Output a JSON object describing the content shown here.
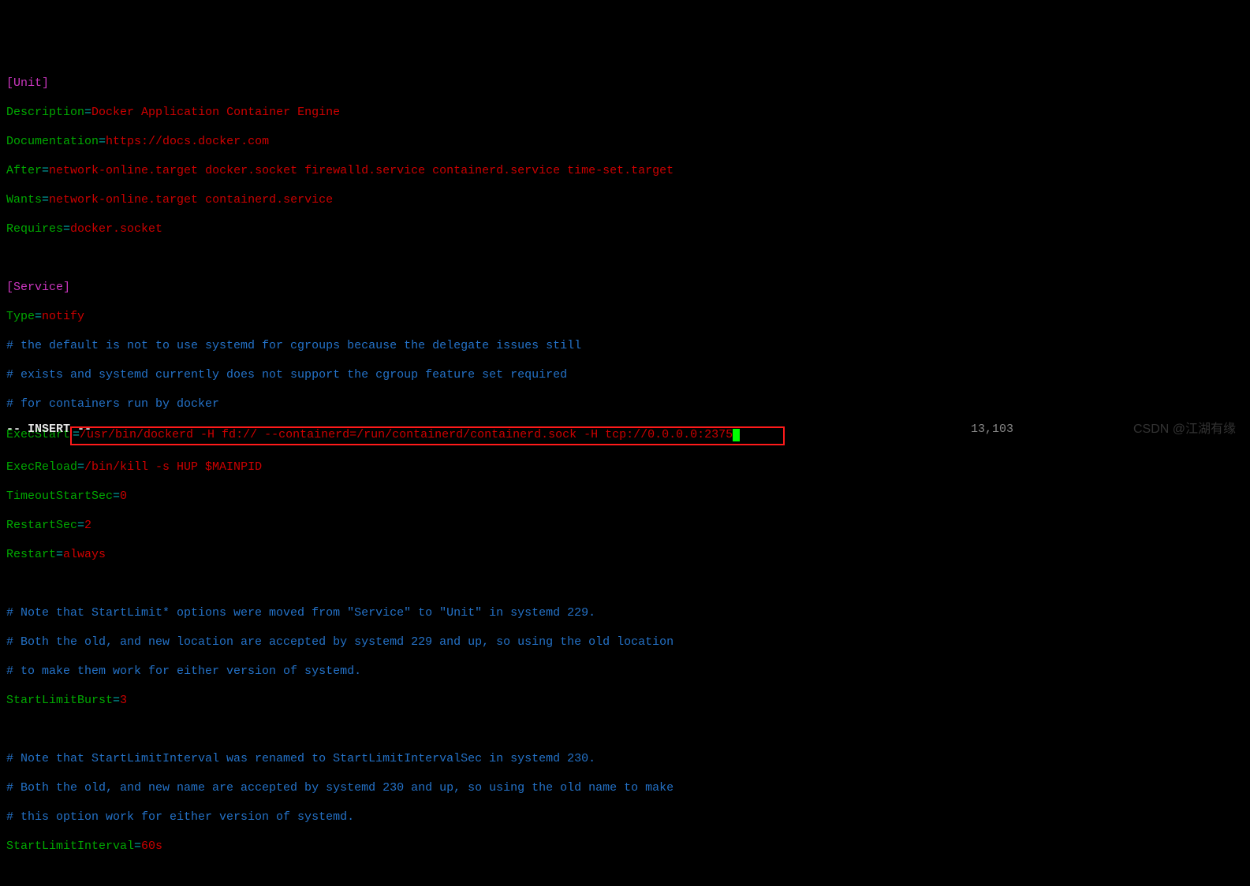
{
  "unit": {
    "header": "[Unit]",
    "description_key": "Description",
    "description_val": "Docker Application Container Engine",
    "documentation_key": "Documentation",
    "documentation_val": "https://docs.docker.com",
    "after_key": "After",
    "after_val": "network-online.target docker.socket firewalld.service containerd.service time-set.target",
    "wants_key": "Wants",
    "wants_val": "network-online.target containerd.service",
    "requires_key": "Requires",
    "requires_val": "docker.socket"
  },
  "service": {
    "header": "[Service]",
    "type_key": "Type",
    "type_val": "notify",
    "comment1": "# the default is not to use systemd for cgroups because the delegate issues still",
    "comment2": "# exists and systemd currently does not support the cgroup feature set required",
    "comment3": "# for containers run by docker",
    "execstart_key": "ExecStart",
    "execstart_val": "/usr/bin/dockerd -H fd:// --containerd=/run/containerd/containerd.sock -H tcp://0.0.0.0:2375",
    "execreload_key": "ExecReload",
    "execreload_val": "/bin/kill -s HUP $MAINPID",
    "timeoutstart_key": "TimeoutStartSec",
    "timeoutstart_val": "0",
    "restartsec_key": "RestartSec",
    "restartsec_val": "2",
    "restart_key": "Restart",
    "restart_val": "always",
    "comment4": "# Note that StartLimit* options were moved from \"Service\" to \"Unit\" in systemd 229.",
    "comment5": "# Both the old, and new location are accepted by systemd 229 and up, so using the old location",
    "comment6": "# to make them work for either version of systemd.",
    "startlimitburst_key": "StartLimitBurst",
    "startlimitburst_val": "3",
    "comment7": "# Note that StartLimitInterval was renamed to StartLimitIntervalSec in systemd 230.",
    "comment8": "# Both the old, and new name are accepted by systemd 230 and up, so using the old name to make",
    "comment9": "# this option work for either version of systemd.",
    "startlimitinterval_key": "StartLimitInterval",
    "startlimitinterval_val": "60s"
  },
  "eq": "=",
  "status": {
    "mode": "-- INSERT --",
    "pos": "13,103"
  },
  "watermark": "CSDN @江湖有缘"
}
